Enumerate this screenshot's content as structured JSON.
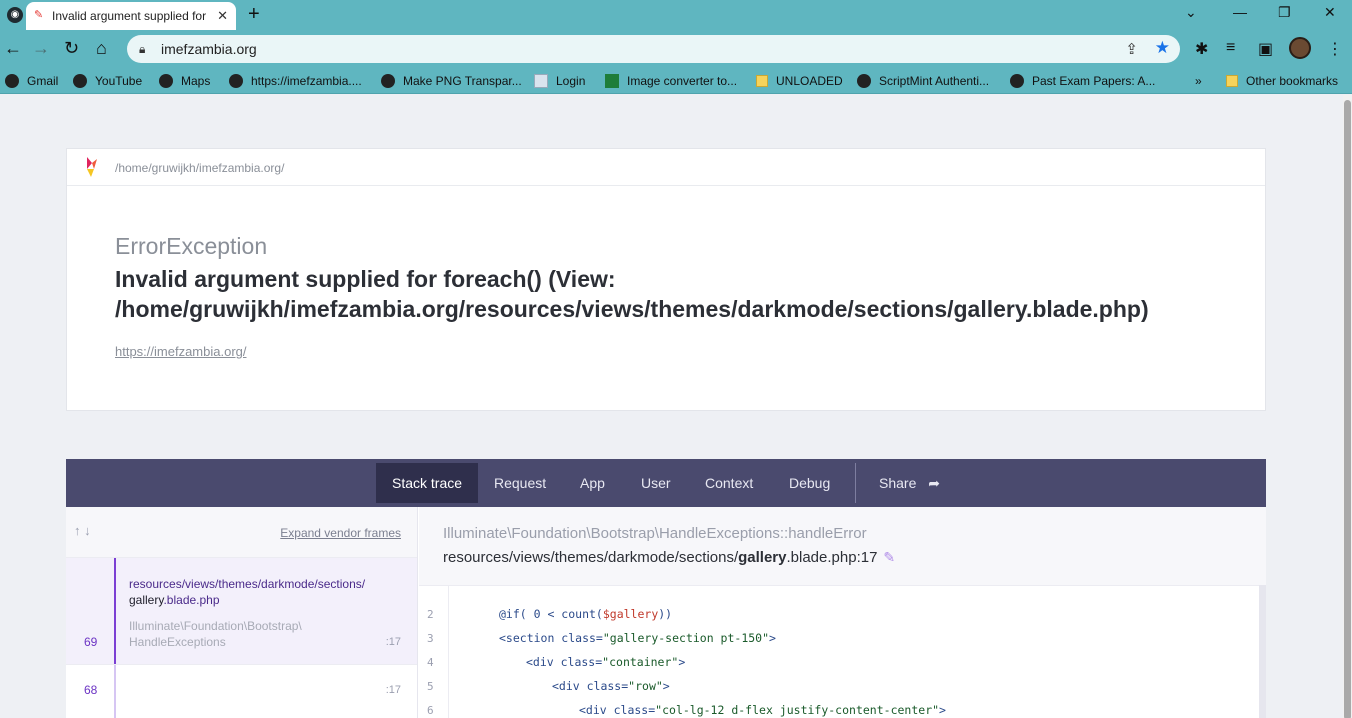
{
  "browser": {
    "tab_title": "Invalid argument supplied for foreach()",
    "url": "imefzambia.org",
    "bookmarks": [
      "Gmail",
      "YouTube",
      "Maps",
      "https://imefzambia....",
      "Make PNG Transpar...",
      "Login",
      "Image converter to...",
      "UNLOADED",
      "ScriptMint Authenti...",
      "Past Exam Papers: A..."
    ],
    "other_bookmarks": "Other bookmarks"
  },
  "error": {
    "path": "/home/gruwijkh/imefzambia.org/",
    "exception_class": "ErrorException",
    "message": "Invalid argument supplied for foreach() (View: /home/gruwijkh/imefzambia.org/resources/views/themes/darkmode/sections/gallery.blade.php)",
    "url": "https://imefzambia.org/"
  },
  "tabs": [
    "Stack trace",
    "Request",
    "App",
    "User",
    "Context",
    "Debug"
  ],
  "share_label": "Share",
  "frames": {
    "expand_label": "Expand vendor frames",
    "items": [
      {
        "number": "69",
        "path_dir": "resources/views/themes/darkmode/sections/",
        "path_file": "gallery",
        "path_ext": ".blade.php",
        "class_ns": "Illuminate\\Foundation\\Bootstrap\\",
        "class_name": "HandleExceptions",
        "line": ":17"
      },
      {
        "number": "68",
        "line": ":17"
      }
    ]
  },
  "detail": {
    "class": "Illuminate\\Foundation\\Bootstrap\\HandleExceptions::handleError",
    "file_dir": "resources/views/themes/darkmode/sections/",
    "file_name": "gallery",
    "file_rest": ".blade.php:17"
  },
  "code": {
    "line_numbers": [
      "2",
      "3",
      "4",
      "5",
      "6"
    ],
    "l2_a": "@if( 0 < count(",
    "l2_var": "$gallery",
    "l2_b": "))",
    "l3_a": "<section class=",
    "l3_str": "\"gallery-section pt-150\"",
    "l3_b": ">",
    "l4_a": "<div class=",
    "l4_str": "\"container\"",
    "l4_b": ">",
    "l5_a": "<div class=",
    "l5_str": "\"row\"",
    "l5_b": ">",
    "l6_a": "<div class=",
    "l6_str": "\"col-lg-12 d-flex justify-content-center\"",
    "l6_b": ">"
  },
  "colors": {
    "chrome": "#5fb6c0",
    "nav": "#4a4a6e",
    "accent": "#7b3fd3"
  }
}
